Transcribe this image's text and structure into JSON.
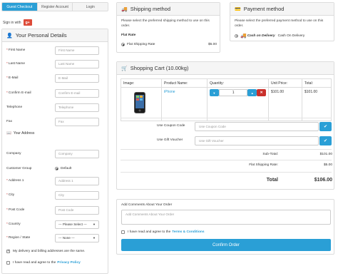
{
  "tabs": [
    {
      "label": "Guest Checkout",
      "active": true
    },
    {
      "label": "Register Account",
      "active": false
    },
    {
      "label": "Login",
      "active": false
    }
  ],
  "signin": {
    "label": "Sign in with",
    "badge": "g+"
  },
  "personal": {
    "title": "Your Personal Details",
    "fields": {
      "first_name": {
        "label": "First Name",
        "placeholder": "First Name"
      },
      "last_name": {
        "label": "Last Name",
        "placeholder": "Last Name"
      },
      "email": {
        "label": "E-Mail",
        "placeholder": "E-Mail"
      },
      "confirm_email": {
        "label": "Confirm E-mail",
        "placeholder": "Confirm E-mail"
      },
      "telephone": {
        "label": "Telephone",
        "placeholder": "Telephone"
      },
      "fax": {
        "label": "Fax",
        "placeholder": "Fax"
      }
    },
    "address_heading": "Your Address",
    "address": {
      "company": {
        "label": "Company",
        "placeholder": "Company"
      },
      "customer_group": {
        "label": "Customer Group",
        "value": "Default"
      },
      "address1": {
        "label": "Address 1",
        "placeholder": "Address 1"
      },
      "city": {
        "label": "City",
        "placeholder": "City"
      },
      "postcode": {
        "label": "Post Code",
        "placeholder": "Post Code"
      },
      "country": {
        "label": "Country",
        "value": "--- Please Select ---"
      },
      "region": {
        "label": "Region / State",
        "value": "--- None ---"
      }
    },
    "same_address": "My delivery and billing addresses are the same.",
    "privacy_text": "I have read and agree to the",
    "privacy_link": "Privacy Policy"
  },
  "shipping": {
    "title": "Shipping method",
    "intro": "Please select the preferred shipping method to use on this order.",
    "group": "Flat Rate",
    "option": "Flat Shipping Rate",
    "price": "$5.00"
  },
  "payment": {
    "title": "Payment method",
    "intro": "Please select the preferred payment method to use on this order.",
    "logo": "Cash on Delivery",
    "option": "Cash On Delivery"
  },
  "cart": {
    "title": "Shopping Cart (10.00kg)",
    "headers": [
      "Image:",
      "Product Name:",
      "Quantity:",
      "Unit Price:",
      "Total:"
    ],
    "item": {
      "name": "iPhone",
      "quantity": "1",
      "unit_price": "$101.00",
      "total": "$101.00"
    },
    "coupon": {
      "label": "Use Coupon Code",
      "placeholder": "Use Coupon Code"
    },
    "voucher": {
      "label": "Use Gift Voucher",
      "placeholder": "Use Gift Voucher"
    },
    "subtotal": {
      "label": "Sub-Total:",
      "value": "$101.00"
    },
    "flat": {
      "label": "Flat Shipping Rate:",
      "value": "$5.00"
    },
    "total": {
      "label": "Total",
      "value": "$106.00"
    }
  },
  "comments": {
    "label": "Add Comments About Your Order",
    "placeholder": "Add Comments About Your Order"
  },
  "terms": {
    "text": "I have read and agree to the",
    "link": "Terms & Conditions"
  },
  "confirm_label": "Confirm Order",
  "colors": {
    "accent": "#2a9fd6",
    "danger": "#c9302c",
    "google": "#dd4b39"
  }
}
